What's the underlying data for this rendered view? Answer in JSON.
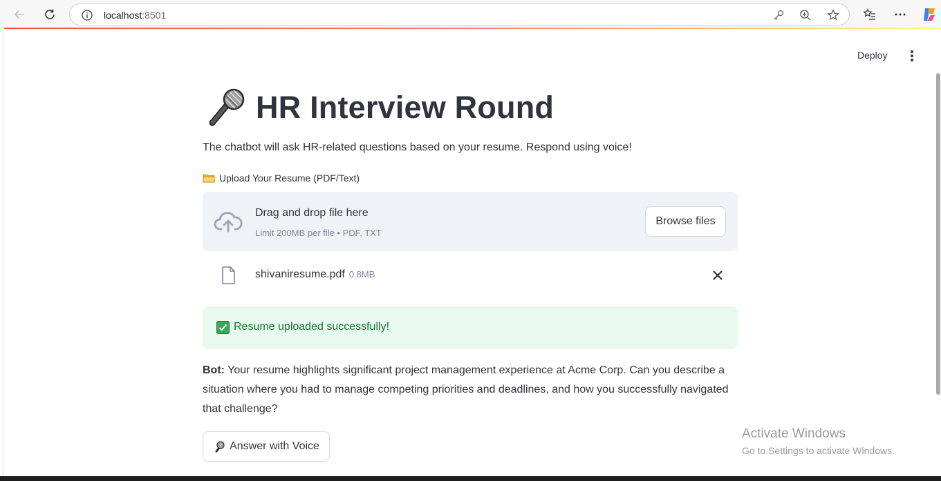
{
  "browser": {
    "url_host": "localhost",
    "url_port": ":8501"
  },
  "header": {
    "deploy_label": "Deploy"
  },
  "page": {
    "title": "HR Interview Round",
    "title_emoji": "microphone-icon",
    "intro": "The chatbot will ask HR-related questions based on your resume. Respond using voice!"
  },
  "uploader": {
    "label": "Upload Your Resume (PDF/Text)",
    "drop_title": "Drag and drop file here",
    "drop_limit": "Limit 200MB per file • PDF, TXT",
    "browse_label": "Browse files",
    "file_name": "shivaniresume.pdf",
    "file_size": "0.8MB"
  },
  "status": {
    "success_text": "Resume uploaded successfully!",
    "success_color": "#177233"
  },
  "chat": {
    "bot_prefix": "Bot:",
    "bot_message": " Your resume highlights significant project management experience at Acme Corp. Can you describe a situation where you had to manage competing priorities and deadlines, and how you successfully navigated that challenge?"
  },
  "actions": {
    "voice_label": "Answer with Voice"
  },
  "watermark": {
    "title": "Activate Windows",
    "subtitle": "Go to Settings to activate Windows."
  },
  "colors": {
    "accent": "#ff4b4b",
    "text": "#31333f",
    "dropzone_bg": "#f0f2f6",
    "success_bg": "#e8f9ee"
  }
}
